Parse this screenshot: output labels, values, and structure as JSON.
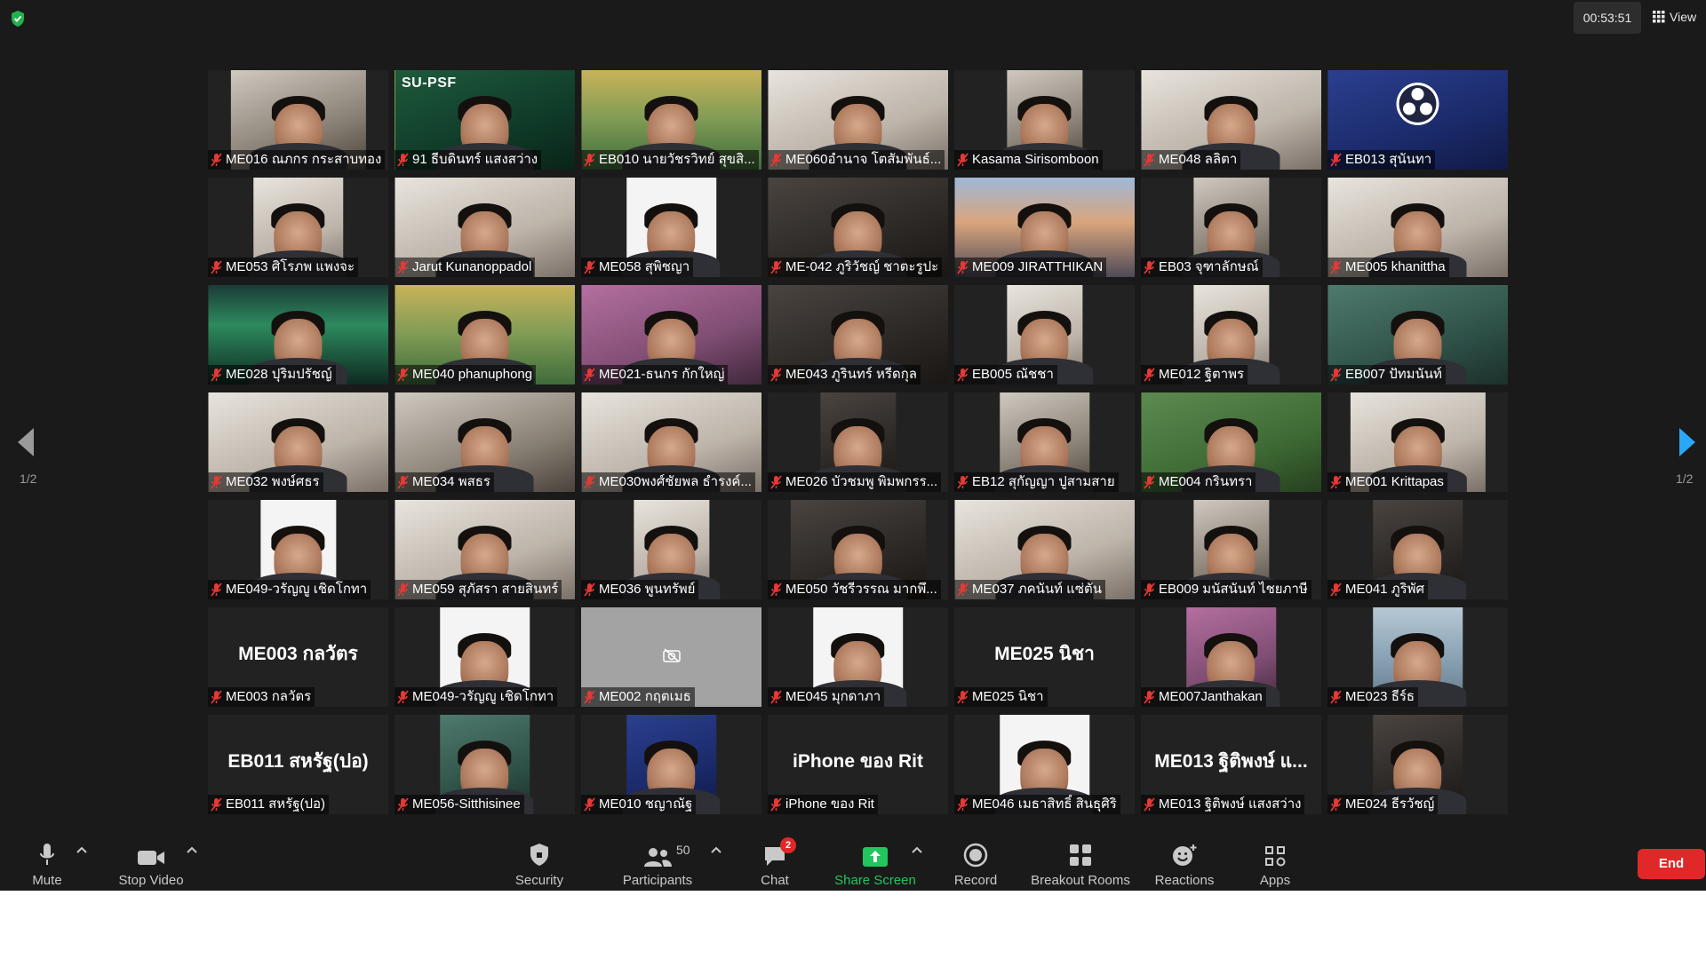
{
  "meeting": {
    "timer": "00:53:51",
    "view_label": "View",
    "page_indicator_left": "1/2",
    "page_indicator_right": "1/2"
  },
  "tiles": [
    {
      "name": "ME016 ณภกร กระสาบทอง",
      "kind": "video",
      "bg": "v-room",
      "w": "w75"
    },
    {
      "name": "91 ธีบดินทร์ แสงสว่าง",
      "kind": "video",
      "bg": "v-green",
      "w": "w100",
      "overlay": "SU-PSF",
      "active": true
    },
    {
      "name": "EB010 นายวัชรวิทย์ สุขสิ...",
      "kind": "video",
      "bg": "v-sky",
      "w": "w100"
    },
    {
      "name": "ME060อำนาจ โตสัมพันธ์...",
      "kind": "video",
      "bg": "v-light",
      "w": "w100"
    },
    {
      "name": "Kasama Sirisomboon",
      "kind": "video",
      "bg": "v-room",
      "w": "w42"
    },
    {
      "name": "ME048 ลลิตา",
      "kind": "video",
      "bg": "v-light",
      "w": "w100"
    },
    {
      "name": "EB013 สุนันทา",
      "kind": "video",
      "bg": "v-blue",
      "w": "w100",
      "obs": true
    },
    {
      "name": "ME053 ศิโรภพ แพงจะ",
      "kind": "video",
      "bg": "v-light",
      "w": "w50"
    },
    {
      "name": "Jarut Kunanoppadol",
      "kind": "video",
      "bg": "v-light",
      "w": "w100"
    },
    {
      "name": "ME058 สุพิชญา",
      "kind": "video",
      "bg": "v-white",
      "w": "w50"
    },
    {
      "name": "ME-042 ภูริวัชญ์ ชาตะรูปะ",
      "kind": "video",
      "bg": "v-dark",
      "w": "w100"
    },
    {
      "name": "ME009 JIRATTHIKAN",
      "kind": "video",
      "bg": "v-city",
      "w": "w100"
    },
    {
      "name": "EB03 จุฑาลักษณ์",
      "kind": "video",
      "bg": "v-room",
      "w": "w42"
    },
    {
      "name": "ME005 khanittha",
      "kind": "video",
      "bg": "v-light",
      "w": "w100"
    },
    {
      "name": "ME028 ปุริมปรัชญ์",
      "kind": "video",
      "bg": "v-aurora",
      "w": "w100"
    },
    {
      "name": "ME040 phanuphong",
      "kind": "video",
      "bg": "v-sky",
      "w": "w100"
    },
    {
      "name": "ME021-ธนกร กักใหญ่",
      "kind": "video",
      "bg": "v-pink",
      "w": "w100"
    },
    {
      "name": "ME043 ภูรินทร์ หรีดกุล",
      "kind": "video",
      "bg": "v-dark",
      "w": "w100"
    },
    {
      "name": "EB005 ณัชชา",
      "kind": "video",
      "bg": "v-light",
      "w": "w42"
    },
    {
      "name": "ME012 ฐิตาพร",
      "kind": "video",
      "bg": "v-light",
      "w": "w42"
    },
    {
      "name": "EB007 ปัทมนันท์",
      "kind": "video",
      "bg": "v-mint",
      "w": "w100"
    },
    {
      "name": "ME032 พงษ์ศธร",
      "kind": "video",
      "bg": "v-light",
      "w": "w100"
    },
    {
      "name": "ME034 พสธร",
      "kind": "video",
      "bg": "v-room",
      "w": "w100"
    },
    {
      "name": "ME030พงศ์ชัยพล ธำรงค์...",
      "kind": "video",
      "bg": "v-light",
      "w": "w100"
    },
    {
      "name": "ME026 บัวชมพู พิมพกรร...",
      "kind": "video",
      "bg": "v-dark",
      "w": "w42"
    },
    {
      "name": "EB12 สุกัญญา ปูสามสาย",
      "kind": "video",
      "bg": "v-room",
      "w": "w50"
    },
    {
      "name": "ME004 กรินทรา",
      "kind": "video",
      "bg": "v-wall",
      "w": "w100"
    },
    {
      "name": "ME001 Krittapas",
      "kind": "video",
      "bg": "v-light",
      "w": "w75"
    },
    {
      "name": "ME049-วรัญญู เชิดโกทา",
      "kind": "video",
      "bg": "v-white",
      "w": "w42"
    },
    {
      "name": "ME059 สุภัสรา สายสินทร์",
      "kind": "video",
      "bg": "v-light",
      "w": "w100"
    },
    {
      "name": "ME036 พูนทรัพย์",
      "kind": "video",
      "bg": "v-light",
      "w": "w42"
    },
    {
      "name": "ME050 วัชรีวรรณ มากพึ...",
      "kind": "video",
      "bg": "v-dark",
      "w": "w75"
    },
    {
      "name": "ME037 ภคนันท์ แซ่ตัน",
      "kind": "video",
      "bg": "v-light",
      "w": "w100"
    },
    {
      "name": "EB009 มนัสนันท์ ไชยภาษี",
      "kind": "video",
      "bg": "v-room",
      "w": "w42"
    },
    {
      "name": "ME041 ภูริพัศ",
      "kind": "video",
      "bg": "v-dark",
      "w": "w50"
    },
    {
      "name": "ME003 กลวัตร",
      "kind": "name",
      "display": "ME003 กลวัตร"
    },
    {
      "name": "ME049-วรัญญู เชิดโกทา",
      "kind": "video",
      "bg": "v-white",
      "w": "w50"
    },
    {
      "name": "ME002 กฤตเมธ",
      "kind": "camoff"
    },
    {
      "name": "ME045 มุกดาภา",
      "kind": "video",
      "bg": "v-white",
      "w": "w50"
    },
    {
      "name": "ME025 นิชา",
      "kind": "name",
      "display": "ME025 นิชา"
    },
    {
      "name": "ME007Janthakan",
      "kind": "video",
      "bg": "v-pink",
      "w": "w50"
    },
    {
      "name": "ME023 ธีร์ธ",
      "kind": "video",
      "bg": "v-sea",
      "w": "w50"
    },
    {
      "name": "EB011 สหรัฐ(ปอ)",
      "kind": "name",
      "display": "EB011 สหรัฐ(ปอ)"
    },
    {
      "name": "ME056-Sitthisinee",
      "kind": "video",
      "bg": "v-mint",
      "w": "w50"
    },
    {
      "name": "ME010 ชญาณัฐ",
      "kind": "video",
      "bg": "v-blue",
      "w": "w50"
    },
    {
      "name": "iPhone ของ Rit",
      "kind": "name",
      "display": "iPhone ของ Rit"
    },
    {
      "name": "ME046 เมธาสิทธิ์ สินธุศิริ",
      "kind": "video",
      "bg": "v-white",
      "w": "w50"
    },
    {
      "name": "ME013 ฐิติพงษ์ แสงสว่าง",
      "kind": "name",
      "display": "ME013 ฐิติพงษ์ แ..."
    },
    {
      "name": "ME024 ธีรวัชญ์",
      "kind": "video",
      "bg": "v-dark",
      "w": "w50"
    }
  ],
  "toolbar": {
    "mute_label": "Mute",
    "stop_video_label": "Stop Video",
    "security_label": "Security",
    "participants_label": "Participants",
    "participants_count": "50",
    "chat_label": "Chat",
    "chat_badge": "2",
    "share_screen_label": "Share Screen",
    "record_label": "Record",
    "breakout_label": "Breakout Rooms",
    "reactions_label": "Reactions",
    "apps_label": "Apps",
    "end_label": "End"
  },
  "colors": {
    "background": "#1a1a1a",
    "active_speaker_border": "#d7e35a",
    "share_green": "#22c55e",
    "end_red": "#e02828",
    "shield_green": "#22b14c"
  }
}
